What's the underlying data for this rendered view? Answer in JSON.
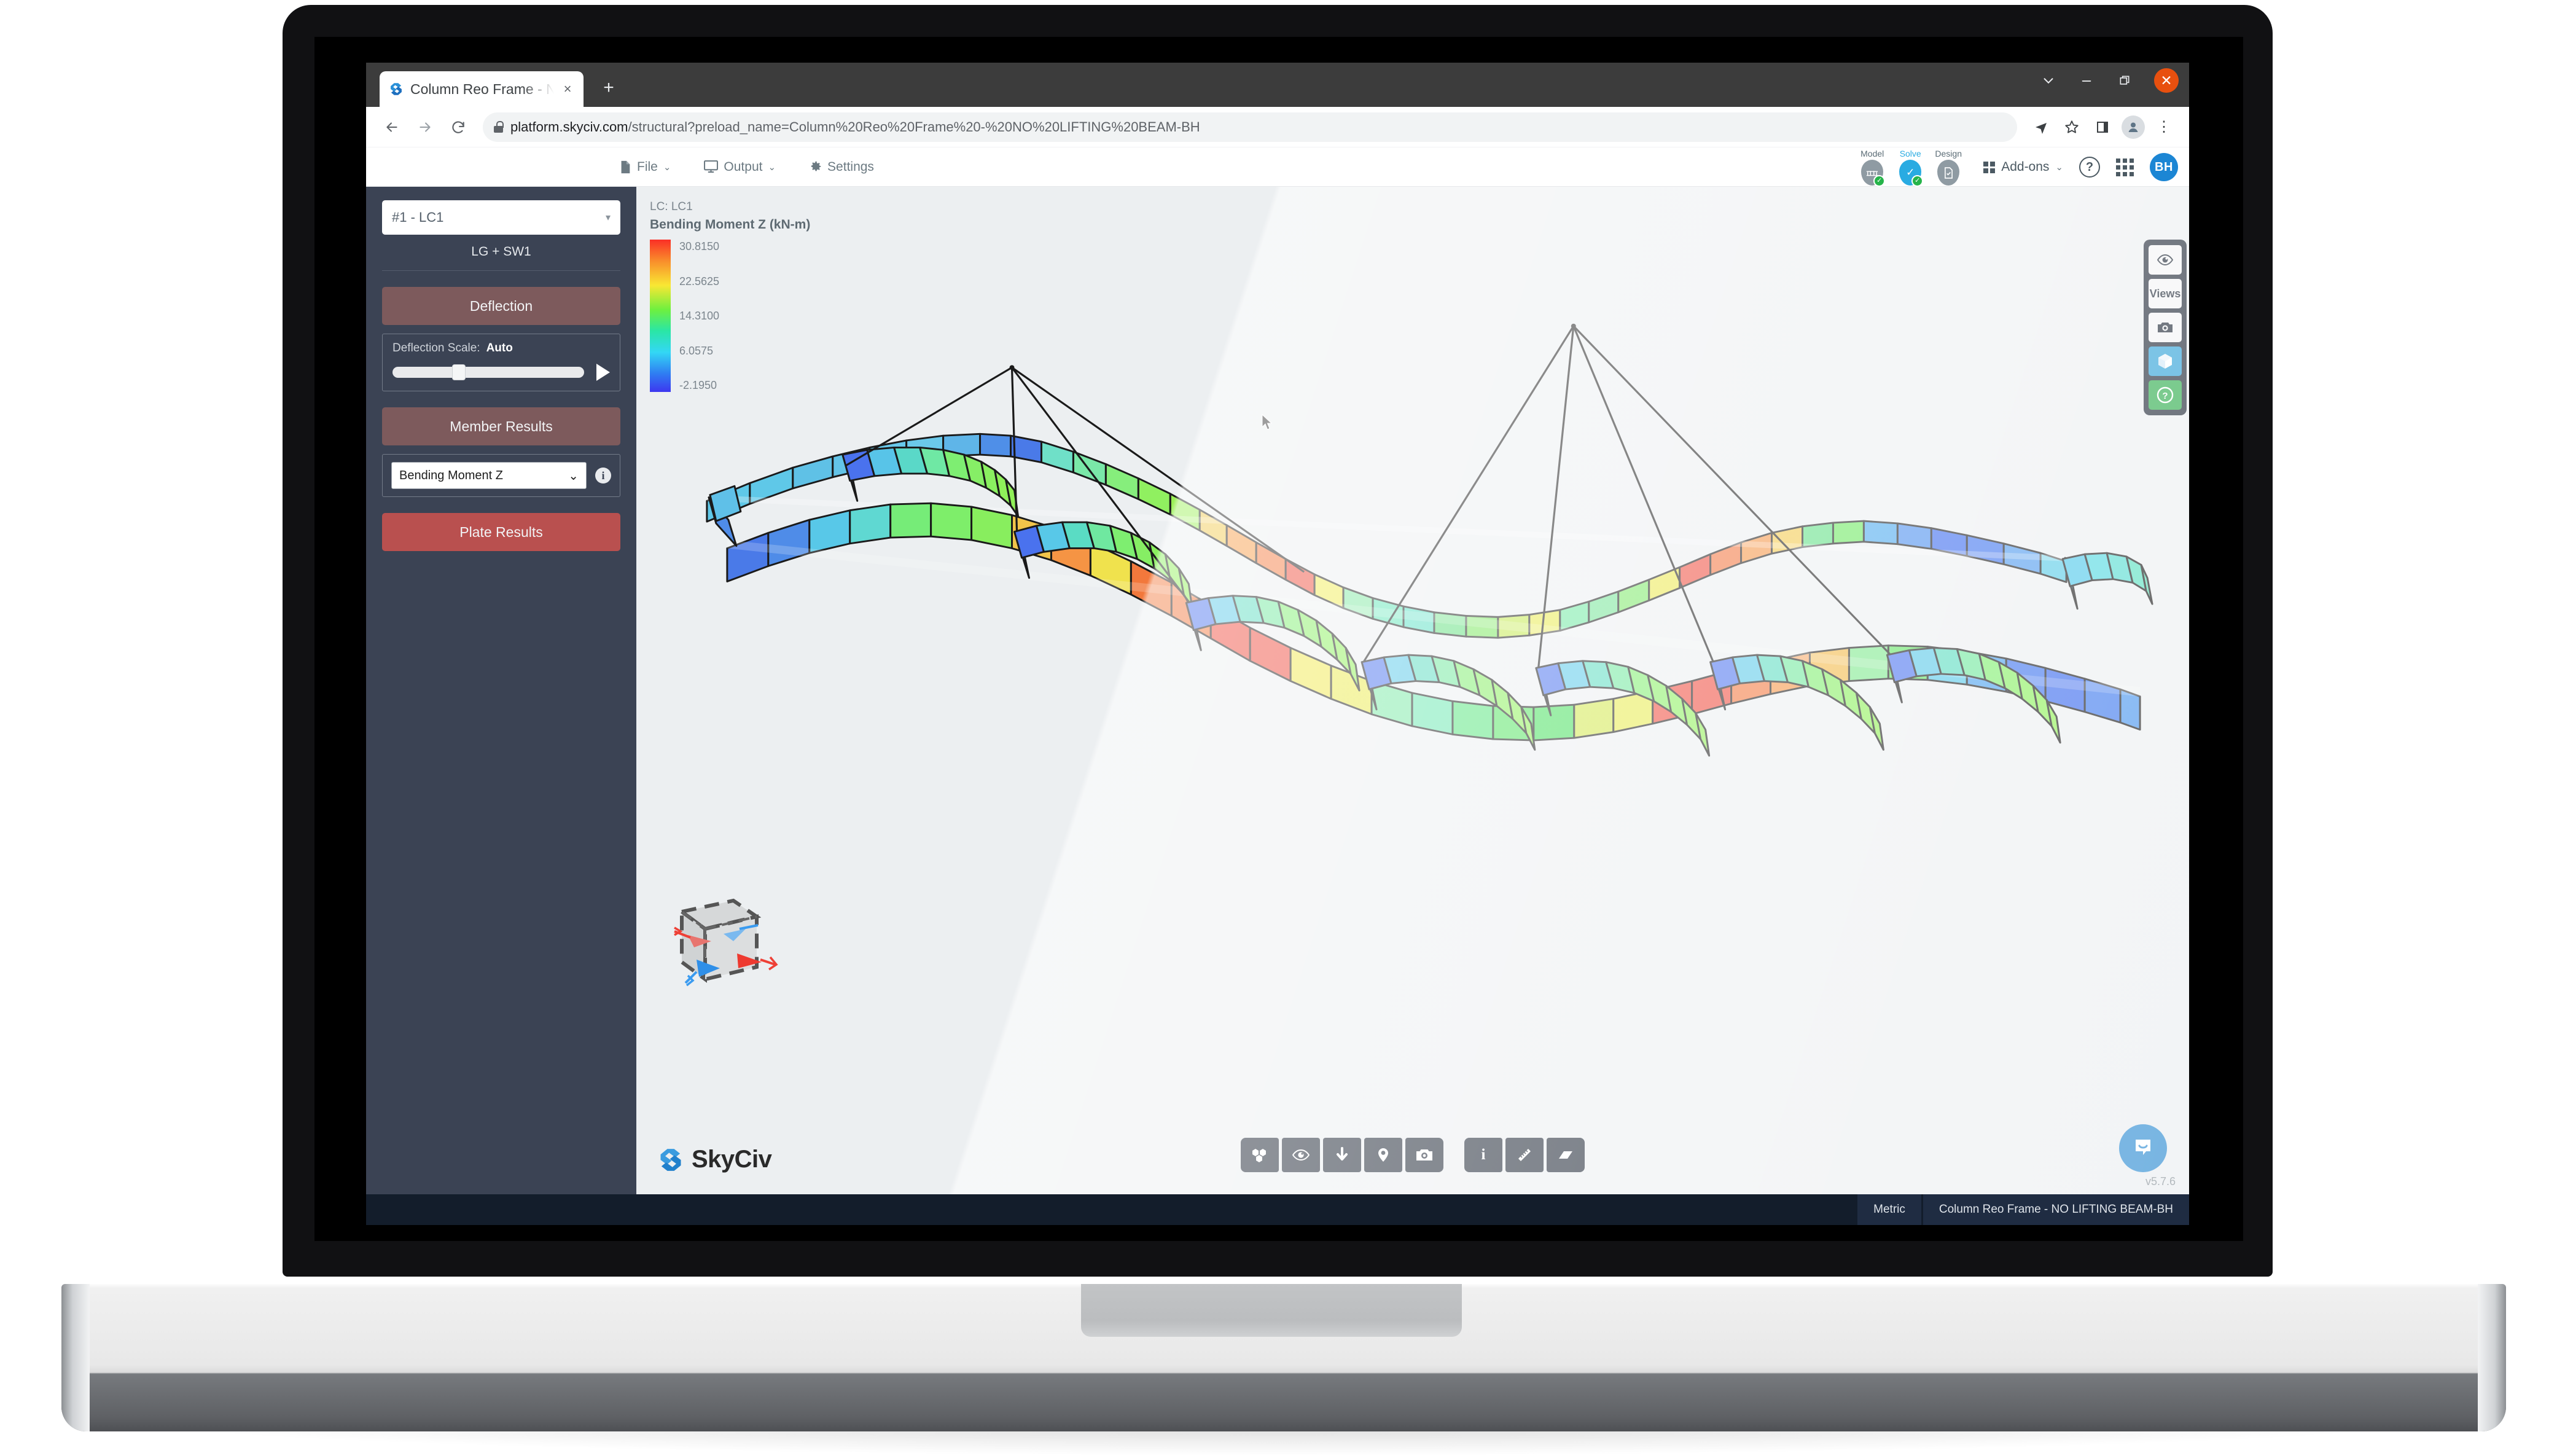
{
  "browser": {
    "tab": {
      "title": "Column Reo Frame - NO L",
      "favicon_name": "skyciv-logo-icon",
      "close_label": "×"
    },
    "newtab_label": "+",
    "window_controls": {
      "dropdown": "⌄",
      "minimize": "—",
      "maximize": "❐",
      "close": "✕"
    },
    "nav": {
      "back": "←",
      "forward": "→",
      "reload": "⟳"
    },
    "url": {
      "host": "platform.skyciv.com",
      "path": "/structural?preload_name=Column%20Reo%20Frame%20-%20NO%20LIFTING%20BEAM-BH",
      "lock_icon": "lock-icon"
    },
    "omni_right": {
      "share": "➤",
      "bookmark": "☆",
      "sidepanel": "◫",
      "profile": "profile-avatar-icon",
      "menu": "⋮"
    }
  },
  "app": {
    "menu": [
      {
        "label": "File",
        "icon": "file-icon",
        "caret": "⌄"
      },
      {
        "label": "Output",
        "icon": "monitor-icon",
        "caret": "⌄"
      },
      {
        "label": "Settings",
        "icon": "gear-icon",
        "caret": ""
      }
    ],
    "stages": [
      {
        "label": "Model",
        "icon": "☳",
        "active": false,
        "checked": true
      },
      {
        "label": "Solve",
        "icon": "✔",
        "active": true,
        "checked": true
      },
      {
        "label": "Design",
        "icon": "☑",
        "active": false,
        "checked": false
      }
    ],
    "addons_label": "Add-ons",
    "addons_caret": "⌄",
    "help_label": "?",
    "user_initials": "BH"
  },
  "sidebar": {
    "load_case": "#1 - LC1",
    "load_case_caret": "▾",
    "load_combo": "LG + SW1",
    "deflection_button": "Deflection",
    "deflection_scale_label": "Deflection Scale:",
    "deflection_scale_value": "Auto",
    "member_results_button": "Member Results",
    "member_result_type": "Bending Moment Z",
    "member_result_caret": "⌄",
    "info_label": "i",
    "plate_results_button": "Plate Results"
  },
  "viewport": {
    "legend_lc": "LC: LC1",
    "legend_title": "Bending Moment Z (kN-m)",
    "legend_ticks": [
      "30.8150",
      "22.5625",
      "14.3100",
      "6.0575",
      "-2.1950"
    ],
    "brand": "SkyCiv",
    "version": "v5.7.6",
    "rail": [
      {
        "name": "visibility-icon",
        "glyph": "◉",
        "style": "light"
      },
      {
        "name": "views-button",
        "glyph": "Views",
        "style": "light"
      },
      {
        "name": "camera-icon",
        "glyph": "▣",
        "style": "light"
      },
      {
        "name": "3d-cube-icon",
        "glyph": "⬡",
        "style": "blue"
      },
      {
        "name": "help-icon",
        "glyph": "?",
        "style": "green"
      }
    ],
    "bottom_tools_left": [
      {
        "name": "render-solid-icon",
        "glyph": "⬟"
      },
      {
        "name": "visibility-icon",
        "glyph": "◉"
      },
      {
        "name": "download-icon",
        "glyph": "⬇"
      },
      {
        "name": "pin-icon",
        "glyph": "⌕"
      },
      {
        "name": "camera-icon",
        "glyph": "▣"
      }
    ],
    "bottom_tools_right": [
      {
        "name": "info-icon",
        "glyph": "i"
      },
      {
        "name": "ruler-icon",
        "glyph": "╱"
      },
      {
        "name": "eraser-icon",
        "glyph": "▱"
      }
    ]
  },
  "statusbar": {
    "units": "Metric",
    "model_name": "Column Reo Frame - NO LIFTING BEAM-BH"
  },
  "chart_data": {
    "type": "heatmap",
    "title": "Bending Moment Z (kN-m)",
    "load_case": "LC1",
    "colorbar_ticks": [
      30.815,
      22.5625,
      14.31,
      6.0575,
      -2.195
    ],
    "colorbar_max": 30.815,
    "colorbar_min": -2.195,
    "units": "kN-m",
    "description": "3D structural frame deflection plot with bending moment Z color map"
  }
}
